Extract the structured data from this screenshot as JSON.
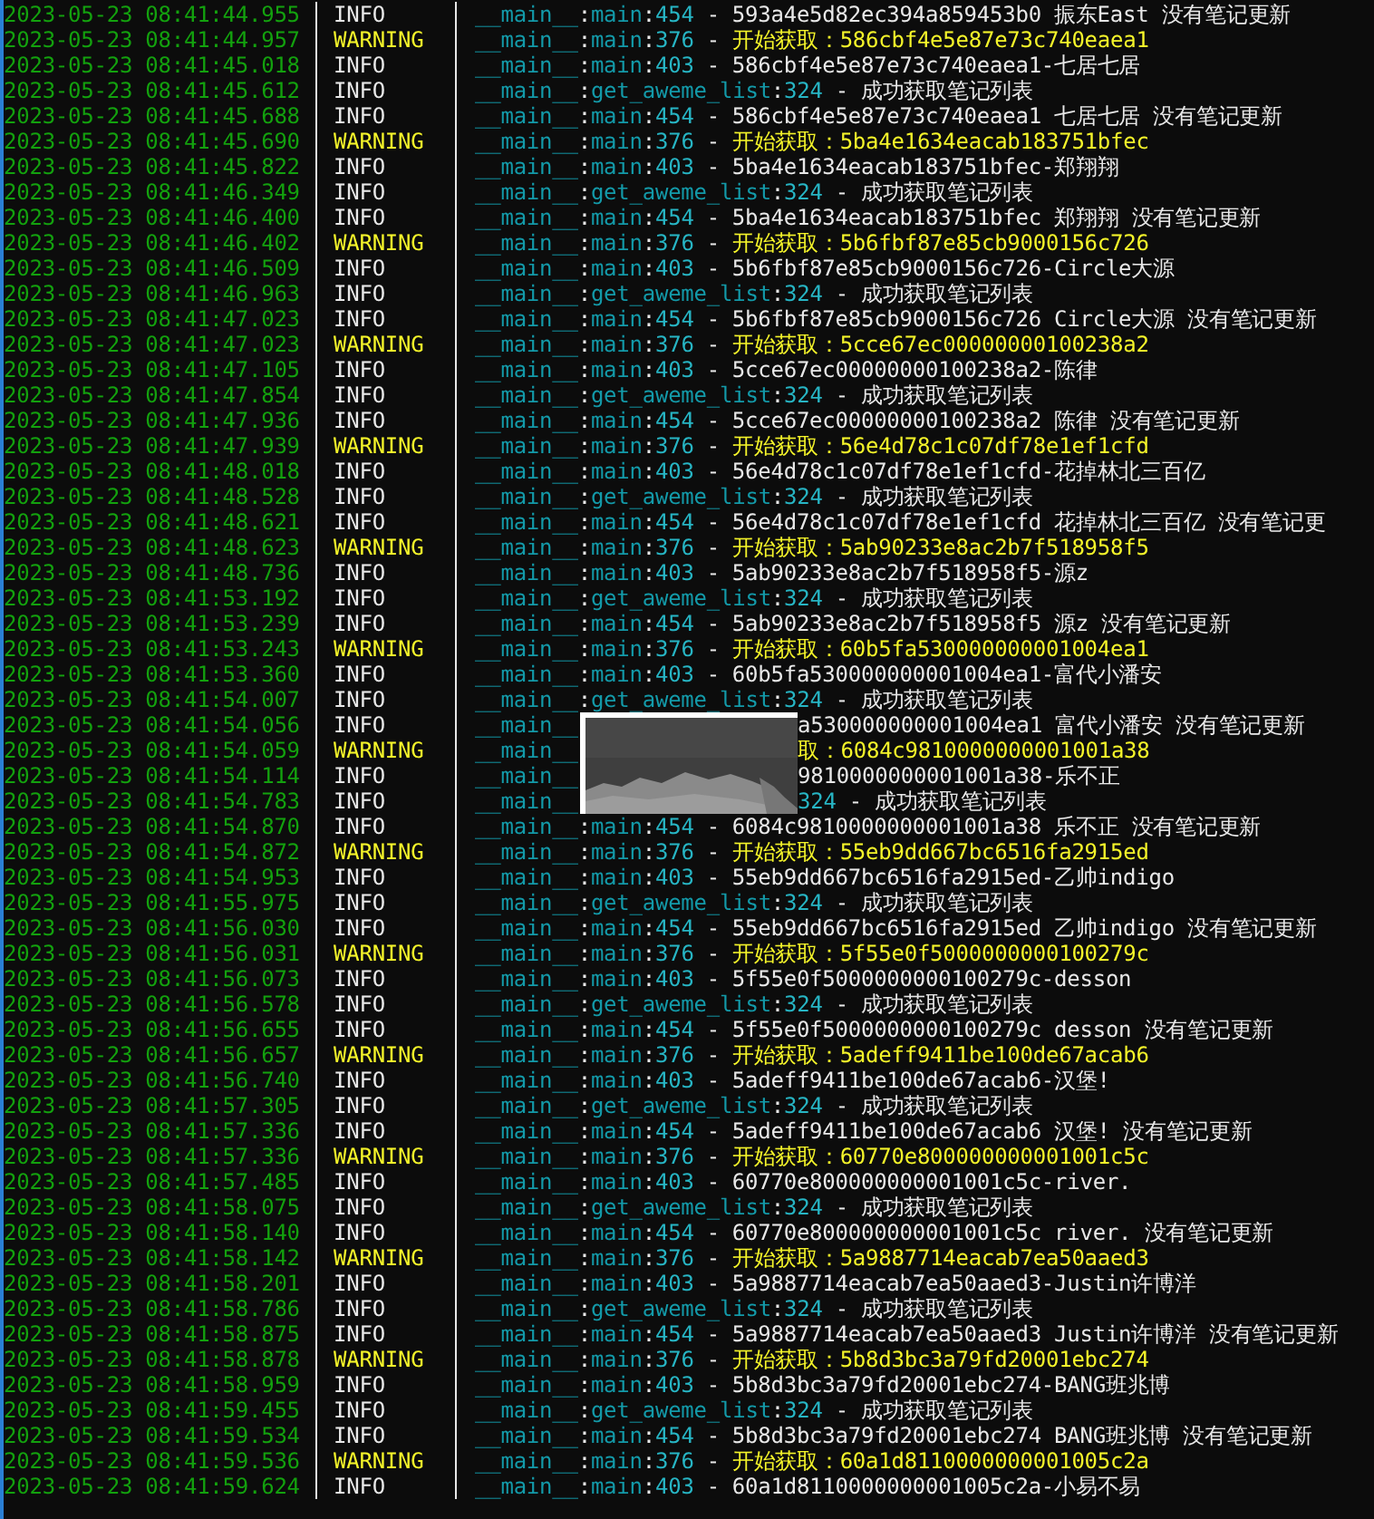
{
  "colon": ":",
  "dash": "-",
  "log_rows": [
    {
      "kind": "full",
      "time": "2023-05-23 08:41:44.955",
      "level": "INFO",
      "module": "__main__",
      "func": "main",
      "line": "454",
      "message": "593a4e5d82ec394a859453b0 振东East 没有笔记更新"
    },
    {
      "kind": "full",
      "time": "2023-05-23 08:41:44.957",
      "level": "WARNING",
      "module": "__main__",
      "func": "main",
      "line": "376",
      "message": "开始获取：586cbf4e5e87e73c740eaea1"
    },
    {
      "kind": "full",
      "time": "2023-05-23 08:41:45.018",
      "level": "INFO",
      "module": "__main__",
      "func": "main",
      "line": "403",
      "message": "586cbf4e5e87e73c740eaea1-七居七居"
    },
    {
      "kind": "full",
      "time": "2023-05-23 08:41:45.612",
      "level": "INFO",
      "module": "__main__",
      "func": "get_aweme_list",
      "line": "324",
      "message": "成功获取笔记列表"
    },
    {
      "kind": "full",
      "time": "2023-05-23 08:41:45.688",
      "level": "INFO",
      "module": "__main__",
      "func": "main",
      "line": "454",
      "message": "586cbf4e5e87e73c740eaea1 七居七居 没有笔记更新"
    },
    {
      "kind": "full",
      "time": "2023-05-23 08:41:45.690",
      "level": "WARNING",
      "module": "__main__",
      "func": "main",
      "line": "376",
      "message": "开始获取：5ba4e1634eacab183751bfec"
    },
    {
      "kind": "full",
      "time": "2023-05-23 08:41:45.822",
      "level": "INFO",
      "module": "__main__",
      "func": "main",
      "line": "403",
      "message": "5ba4e1634eacab183751bfec-郑翔翔"
    },
    {
      "kind": "full",
      "time": "2023-05-23 08:41:46.349",
      "level": "INFO",
      "module": "__main__",
      "func": "get_aweme_list",
      "line": "324",
      "message": "成功获取笔记列表"
    },
    {
      "kind": "full",
      "time": "2023-05-23 08:41:46.400",
      "level": "INFO",
      "module": "__main__",
      "func": "main",
      "line": "454",
      "message": "5ba4e1634eacab183751bfec 郑翔翔 没有笔记更新"
    },
    {
      "kind": "full",
      "time": "2023-05-23 08:41:46.402",
      "level": "WARNING",
      "module": "__main__",
      "func": "main",
      "line": "376",
      "message": "开始获取：5b6fbf87e85cb9000156c726"
    },
    {
      "kind": "full",
      "time": "2023-05-23 08:41:46.509",
      "level": "INFO",
      "module": "__main__",
      "func": "main",
      "line": "403",
      "message": "5b6fbf87e85cb9000156c726-Circle大源"
    },
    {
      "kind": "full",
      "time": "2023-05-23 08:41:46.963",
      "level": "INFO",
      "module": "__main__",
      "func": "get_aweme_list",
      "line": "324",
      "message": "成功获取笔记列表"
    },
    {
      "kind": "full",
      "time": "2023-05-23 08:41:47.023",
      "level": "INFO",
      "module": "__main__",
      "func": "main",
      "line": "454",
      "message": "5b6fbf87e85cb9000156c726 Circle大源 没有笔记更新"
    },
    {
      "kind": "full",
      "time": "2023-05-23 08:41:47.023",
      "level": "WARNING",
      "module": "__main__",
      "func": "main",
      "line": "376",
      "message": "开始获取：5cce67ec00000000100238a2"
    },
    {
      "kind": "full",
      "time": "2023-05-23 08:41:47.105",
      "level": "INFO",
      "module": "__main__",
      "func": "main",
      "line": "403",
      "message": "5cce67ec00000000100238a2-陈律"
    },
    {
      "kind": "full",
      "time": "2023-05-23 08:41:47.854",
      "level": "INFO",
      "module": "__main__",
      "func": "get_aweme_list",
      "line": "324",
      "message": "成功获取笔记列表"
    },
    {
      "kind": "full",
      "time": "2023-05-23 08:41:47.936",
      "level": "INFO",
      "module": "__main__",
      "func": "main",
      "line": "454",
      "message": "5cce67ec00000000100238a2 陈律 没有笔记更新"
    },
    {
      "kind": "full",
      "time": "2023-05-23 08:41:47.939",
      "level": "WARNING",
      "module": "__main__",
      "func": "main",
      "line": "376",
      "message": "开始获取：56e4d78c1c07df78e1ef1cfd"
    },
    {
      "kind": "full",
      "time": "2023-05-23 08:41:48.018",
      "level": "INFO",
      "module": "__main__",
      "func": "main",
      "line": "403",
      "message": "56e4d78c1c07df78e1ef1cfd-花掉林北三百亿"
    },
    {
      "kind": "full",
      "time": "2023-05-23 08:41:48.528",
      "level": "INFO",
      "module": "__main__",
      "func": "get_aweme_list",
      "line": "324",
      "message": "成功获取笔记列表"
    },
    {
      "kind": "full",
      "time": "2023-05-23 08:41:48.621",
      "level": "INFO",
      "module": "__main__",
      "func": "main",
      "line": "454",
      "message": "56e4d78c1c07df78e1ef1cfd 花掉林北三百亿 没有笔记更"
    },
    {
      "kind": "full",
      "time": "2023-05-23 08:41:48.623",
      "level": "WARNING",
      "module": "__main__",
      "func": "main",
      "line": "376",
      "message": "开始获取：5ab90233e8ac2b7f518958f5"
    },
    {
      "kind": "full",
      "time": "2023-05-23 08:41:48.736",
      "level": "INFO",
      "module": "__main__",
      "func": "main",
      "line": "403",
      "message": "5ab90233e8ac2b7f518958f5-源z"
    },
    {
      "kind": "full",
      "time": "2023-05-23 08:41:53.192",
      "level": "INFO",
      "module": "__main__",
      "func": "get_aweme_list",
      "line": "324",
      "message": "成功获取笔记列表"
    },
    {
      "kind": "full",
      "time": "2023-05-23 08:41:53.239",
      "level": "INFO",
      "module": "__main__",
      "func": "main",
      "line": "454",
      "message": "5ab90233e8ac2b7f518958f5 源z 没有笔记更新"
    },
    {
      "kind": "full",
      "time": "2023-05-23 08:41:53.243",
      "level": "WARNING",
      "module": "__main__",
      "func": "main",
      "line": "376",
      "message": "开始获取：60b5fa530000000001004ea1"
    },
    {
      "kind": "full",
      "time": "2023-05-23 08:41:53.360",
      "level": "INFO",
      "module": "__main__",
      "func": "main",
      "line": "403",
      "message": "60b5fa530000000001004ea1-富代小潘安"
    },
    {
      "kind": "full",
      "time": "2023-05-23 08:41:54.007",
      "level": "INFO",
      "module": "__main__",
      "func": "get_aweme_list",
      "line": "324",
      "message": "成功获取笔记列表"
    },
    {
      "kind": "covered",
      "time": "2023-05-23 08:41:54.056",
      "level": "INFO",
      "module": "__main__",
      "tail": [
        {
          "kind": "message",
          "text": "a530000000001004ea1 富代小潘安 没有笔记更新"
        }
      ]
    },
    {
      "kind": "covered",
      "time": "2023-05-23 08:41:54.059",
      "level": "WARNING",
      "module": "__main__",
      "tail": [
        {
          "kind": "message",
          "text": "取：6084c9810000000001001a38"
        }
      ]
    },
    {
      "kind": "covered",
      "time": "2023-05-23 08:41:54.114",
      "level": "INFO",
      "module": "__main__",
      "tail": [
        {
          "kind": "message",
          "text": "9810000000001001a38-乐不正"
        }
      ]
    },
    {
      "kind": "covered",
      "time": "2023-05-23 08:41:54.783",
      "level": "INFO",
      "module": "__main__",
      "tail": [
        {
          "kind": "line",
          "text": "324"
        },
        {
          "kind": "dash",
          "text": "-"
        },
        {
          "kind": "message",
          "text": "成功获取笔记列表"
        }
      ]
    },
    {
      "kind": "full",
      "time": "2023-05-23 08:41:54.870",
      "level": "INFO",
      "module": "__main__",
      "func": "main",
      "line": "454",
      "message": "6084c9810000000001001a38 乐不正 没有笔记更新"
    },
    {
      "kind": "full",
      "time": "2023-05-23 08:41:54.872",
      "level": "WARNING",
      "module": "__main__",
      "func": "main",
      "line": "376",
      "message": "开始获取：55eb9dd667bc6516fa2915ed"
    },
    {
      "kind": "full",
      "time": "2023-05-23 08:41:54.953",
      "level": "INFO",
      "module": "__main__",
      "func": "main",
      "line": "403",
      "message": "55eb9dd667bc6516fa2915ed-乙帅indigo"
    },
    {
      "kind": "full",
      "time": "2023-05-23 08:41:55.975",
      "level": "INFO",
      "module": "__main__",
      "func": "get_aweme_list",
      "line": "324",
      "message": "成功获取笔记列表"
    },
    {
      "kind": "full",
      "time": "2023-05-23 08:41:56.030",
      "level": "INFO",
      "module": "__main__",
      "func": "main",
      "line": "454",
      "message": "55eb9dd667bc6516fa2915ed 乙帅indigo 没有笔记更新"
    },
    {
      "kind": "full",
      "time": "2023-05-23 08:41:56.031",
      "level": "WARNING",
      "module": "__main__",
      "func": "main",
      "line": "376",
      "message": "开始获取：5f55e0f5000000000100279c"
    },
    {
      "kind": "full",
      "time": "2023-05-23 08:41:56.073",
      "level": "INFO",
      "module": "__main__",
      "func": "main",
      "line": "403",
      "message": "5f55e0f5000000000100279c-desson"
    },
    {
      "kind": "full",
      "time": "2023-05-23 08:41:56.578",
      "level": "INFO",
      "module": "__main__",
      "func": "get_aweme_list",
      "line": "324",
      "message": "成功获取笔记列表"
    },
    {
      "kind": "full",
      "time": "2023-05-23 08:41:56.655",
      "level": "INFO",
      "module": "__main__",
      "func": "main",
      "line": "454",
      "message": "5f55e0f5000000000100279c desson 没有笔记更新"
    },
    {
      "kind": "full",
      "time": "2023-05-23 08:41:56.657",
      "level": "WARNING",
      "module": "__main__",
      "func": "main",
      "line": "376",
      "message": "开始获取：5adeff9411be100de67acab6"
    },
    {
      "kind": "full",
      "time": "2023-05-23 08:41:56.740",
      "level": "INFO",
      "module": "__main__",
      "func": "main",
      "line": "403",
      "message": "5adeff9411be100de67acab6-汉堡!"
    },
    {
      "kind": "full",
      "time": "2023-05-23 08:41:57.305",
      "level": "INFO",
      "module": "__main__",
      "func": "get_aweme_list",
      "line": "324",
      "message": "成功获取笔记列表"
    },
    {
      "kind": "full",
      "time": "2023-05-23 08:41:57.336",
      "level": "INFO",
      "module": "__main__",
      "func": "main",
      "line": "454",
      "message": "5adeff9411be100de67acab6 汉堡!  没有笔记更新"
    },
    {
      "kind": "full",
      "time": "2023-05-23 08:41:57.336",
      "level": "WARNING",
      "module": "__main__",
      "func": "main",
      "line": "376",
      "message": "开始获取：60770e800000000001001c5c"
    },
    {
      "kind": "full",
      "time": "2023-05-23 08:41:57.485",
      "level": "INFO",
      "module": "__main__",
      "func": "main",
      "line": "403",
      "message": "60770e800000000001001c5c-river."
    },
    {
      "kind": "full",
      "time": "2023-05-23 08:41:58.075",
      "level": "INFO",
      "module": "__main__",
      "func": "get_aweme_list",
      "line": "324",
      "message": "成功获取笔记列表"
    },
    {
      "kind": "full",
      "time": "2023-05-23 08:41:58.140",
      "level": "INFO",
      "module": "__main__",
      "func": "main",
      "line": "454",
      "message": "60770e800000000001001c5c river. 没有笔记更新"
    },
    {
      "kind": "full",
      "time": "2023-05-23 08:41:58.142",
      "level": "WARNING",
      "module": "__main__",
      "func": "main",
      "line": "376",
      "message": "开始获取：5a9887714eacab7ea50aaed3"
    },
    {
      "kind": "full",
      "time": "2023-05-23 08:41:58.201",
      "level": "INFO",
      "module": "__main__",
      "func": "main",
      "line": "403",
      "message": "5a9887714eacab7ea50aaed3-Justin许博洋"
    },
    {
      "kind": "full",
      "time": "2023-05-23 08:41:58.786",
      "level": "INFO",
      "module": "__main__",
      "func": "get_aweme_list",
      "line": "324",
      "message": "成功获取笔记列表"
    },
    {
      "kind": "full",
      "time": "2023-05-23 08:41:58.875",
      "level": "INFO",
      "module": "__main__",
      "func": "main",
      "line": "454",
      "message": "5a9887714eacab7ea50aaed3 Justin许博洋 没有笔记更新"
    },
    {
      "kind": "full",
      "time": "2023-05-23 08:41:58.878",
      "level": "WARNING",
      "module": "__main__",
      "func": "main",
      "line": "376",
      "message": "开始获取：5b8d3bc3a79fd20001ebc274"
    },
    {
      "kind": "full",
      "time": "2023-05-23 08:41:58.959",
      "level": "INFO",
      "module": "__main__",
      "func": "main",
      "line": "403",
      "message": "5b8d3bc3a79fd20001ebc274-BANG班兆博"
    },
    {
      "kind": "full",
      "time": "2023-05-23 08:41:59.455",
      "level": "INFO",
      "module": "__main__",
      "func": "get_aweme_list",
      "line": "324",
      "message": "成功获取笔记列表"
    },
    {
      "kind": "full",
      "time": "2023-05-23 08:41:59.534",
      "level": "INFO",
      "module": "__main__",
      "func": "main",
      "line": "454",
      "message": "5b8d3bc3a79fd20001ebc274 BANG班兆博 没有笔记更新"
    },
    {
      "kind": "full",
      "time": "2023-05-23 08:41:59.536",
      "level": "WARNING",
      "module": "__main__",
      "func": "main",
      "line": "376",
      "message": "开始获取：60a1d8110000000001005c2a"
    },
    {
      "kind": "full",
      "time": "2023-05-23 08:41:59.624",
      "level": "INFO",
      "module": "__main__",
      "func": "main",
      "line": "403",
      "message": "60a1d8110000000001005c2a-小易不易"
    }
  ]
}
